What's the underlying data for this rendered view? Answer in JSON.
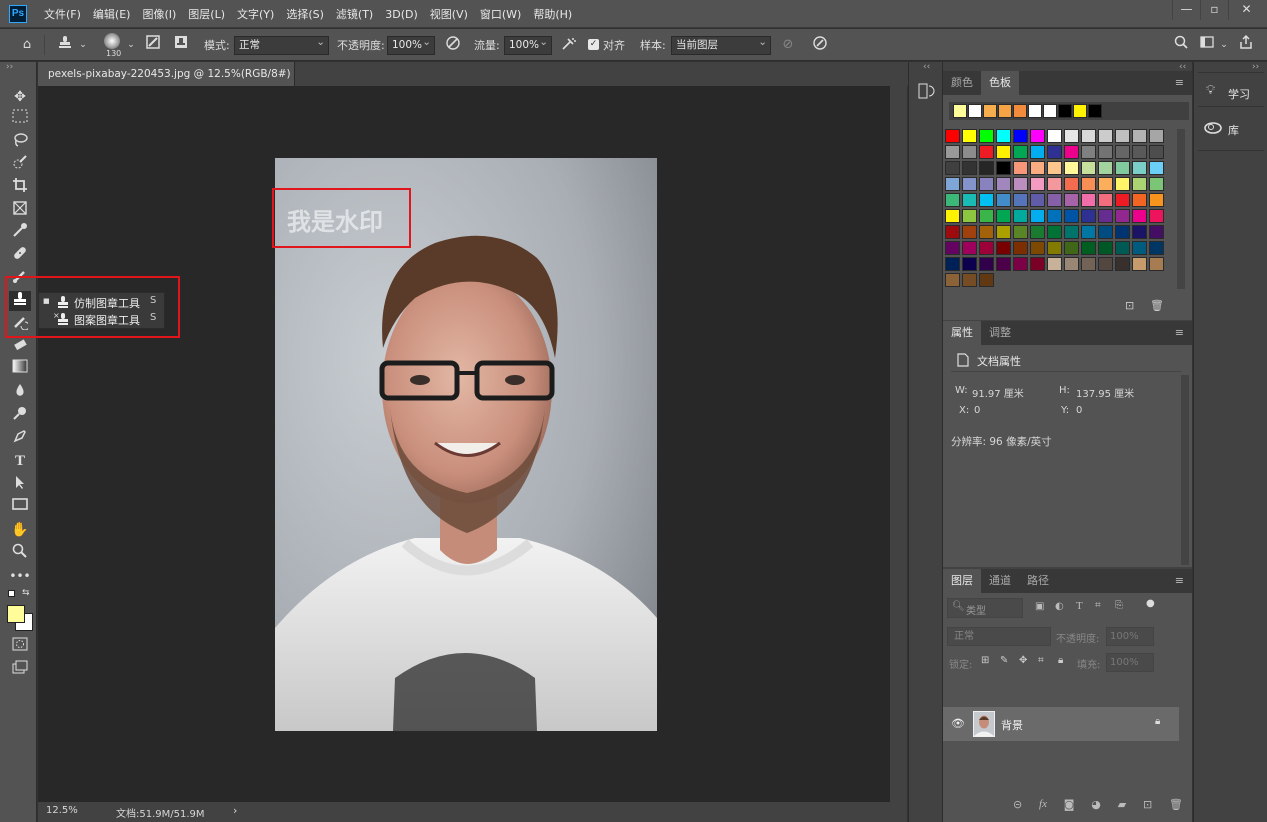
{
  "app": {
    "logo": "Ps"
  },
  "menu": [
    "文件(F)",
    "编辑(E)",
    "图像(I)",
    "图层(L)",
    "文字(Y)",
    "选择(S)",
    "滤镜(T)",
    "3D(D)",
    "视图(V)",
    "窗口(W)",
    "帮助(H)"
  ],
  "window_controls": {
    "minimize": "—",
    "restore": "▫",
    "close": "✕"
  },
  "options": {
    "brush_size": "130",
    "mode_label": "模式:",
    "mode_value": "正常",
    "opacity_label": "不透明度:",
    "opacity_value": "100%",
    "flow_label": "流量:",
    "flow_value": "100%",
    "align_label": "对齐",
    "sample_label": "样本:",
    "sample_value": "当前图层"
  },
  "document": {
    "tab_title": "pexels-pixabay-220453.jpg @ 12.5%(RGB/8#) *",
    "tab_close": "×"
  },
  "flyout": {
    "items": [
      {
        "label": "仿制图章工具",
        "shortcut": "S"
      },
      {
        "label": "图案图章工具",
        "shortcut": "S"
      }
    ]
  },
  "status": {
    "zoom": "12.5%",
    "doc": "文档:51.9M/51.9M",
    "arrow": "›"
  },
  "swatches_panel": {
    "tabs": [
      "颜色",
      "色板"
    ],
    "recent": [
      "#fffd9a",
      "#ffffff",
      "#f5ad4e",
      "#f5a445",
      "#f28c3c",
      "#ffffff",
      "#ffffff",
      "#000000",
      "#fff200",
      "#000000"
    ],
    "rows": [
      [
        "#ff0000",
        "#ffff00",
        "#00ff00",
        "#00ffff",
        "#0000ff",
        "#ff00ff",
        "#ffffff",
        "#e6e6e6",
        "#d9d9d9",
        "#cccccc",
        "#bfbfbf",
        "#b3b3b3",
        "#a6a6a6"
      ],
      [
        "#999999",
        "#8c8c8c",
        "#ed1c24",
        "#fff200",
        "#00a651",
        "#00aeef",
        "#2e3192",
        "#ec008c",
        "#808080",
        "#737373",
        "#666666",
        "#595959",
        "#4d4d4d"
      ],
      [
        "#404040",
        "#333333",
        "#262626",
        "#000000",
        "#f7977a",
        "#fbad82",
        "#fdc68c",
        "#fff799",
        "#c6df9c",
        "#a4d49d",
        "#81ca9d",
        "#7bcdc8",
        "#6ccff7"
      ],
      [
        "#7ea7d8",
        "#8493ca",
        "#8882be",
        "#a187be",
        "#bc8dbf",
        "#f49bc1",
        "#f5989d",
        "#f26c4f",
        "#f68e56",
        "#fbaf5c",
        "#fff467",
        "#acd372",
        "#7cc576"
      ],
      [
        "#3bb878",
        "#1abbb4",
        "#00bff3",
        "#438cca",
        "#5574b9",
        "#605ca8",
        "#855fa8",
        "#a763a8",
        "#f06eaa",
        "#f26d7d",
        "#ed1c24",
        "#f26522",
        "#f7941d"
      ],
      [
        "#fff200",
        "#8dc63f",
        "#39b54a",
        "#00a651",
        "#00a99d",
        "#00aeef",
        "#0072bc",
        "#0054a6",
        "#2e3192",
        "#662d91",
        "#92278f",
        "#ec008c",
        "#ed145b"
      ],
      [
        "#9e0b0f",
        "#a0410d",
        "#a36209",
        "#aba000",
        "#598527",
        "#1a7b30",
        "#007236",
        "#00746b",
        "#0076a3",
        "#004b80",
        "#003471",
        "#1b1464",
        "#440e62"
      ],
      [
        "#630460",
        "#9e005d",
        "#9e0039",
        "#790000",
        "#7b2e00",
        "#7d4900",
        "#827b00",
        "#406618",
        "#005e20",
        "#005826",
        "#005952",
        "#005b7f",
        "#003663"
      ],
      [
        "#002157",
        "#0d004c",
        "#32004b",
        "#4b0049",
        "#7b0046",
        "#7a0026",
        "#c7b299",
        "#998675",
        "#736357",
        "#534741",
        "#37302d",
        "#c69c6d",
        "#a67c52"
      ],
      [
        "#8c6239",
        "#754c24",
        "#603913"
      ]
    ]
  },
  "properties_panel": {
    "tabs": [
      "属性",
      "调整"
    ],
    "heading": "文档属性",
    "w_label": "W:",
    "w_value": "91.97 厘米",
    "h_label": "H:",
    "h_value": "137.95 厘米",
    "x_label": "X:",
    "x_value": "0",
    "y_label": "Y:",
    "y_value": "0",
    "resolution": "分辨率: 96 像素/英寸"
  },
  "layers_panel": {
    "tabs": [
      "图层",
      "通道",
      "路径"
    ],
    "filter_placeholder": "类型",
    "blend_mode": "正常",
    "opacity_label": "不透明度:",
    "opacity_value": "100%",
    "lock_label": "锁定:",
    "fill_label": "填充:",
    "fill_value": "100%",
    "layers": [
      {
        "name": "背景"
      }
    ]
  },
  "right_dock": {
    "learn": "学习",
    "libraries": "库"
  }
}
